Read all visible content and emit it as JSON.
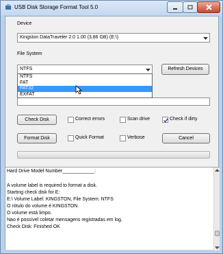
{
  "window": {
    "title": "USB Disk Storage Format Tool 5.0"
  },
  "device": {
    "label": "Device",
    "selected": "Kingston  DataTraveler 2.0  1.00 (3,86 GB) (E:\\)"
  },
  "file_system": {
    "label": "File System",
    "selected": "NTFS",
    "options": [
      "NTFS",
      "FAT",
      "FAT32",
      "EXFAT"
    ],
    "highlighted": "FAT32"
  },
  "buttons": {
    "refresh": "Refresh Devices",
    "check_disk": "Check Disk",
    "format_disk": "Format Disk",
    "cancel": "Cancel"
  },
  "checkboxes": {
    "correct_errors": {
      "label": "Correct errors",
      "checked": false
    },
    "scan_drive": {
      "label": "Scan drive",
      "checked": false
    },
    "check_if_dirty": {
      "label": "Check if dirty",
      "checked": true
    },
    "quick_format": {
      "label": "Quick Format",
      "checked": false
    },
    "verbose": {
      "label": "Verbose",
      "checked": false
    }
  },
  "progress": {
    "value": 0
  },
  "log": {
    "lines": [
      "Hard Drive Model Number____________:",
      "",
      "A volume label is required to format a disk.",
      "Starting check disk for E:",
      "E:\\ Volume Label: KINGSTON, File System: NTFS",
      "O rótulo do volume é KINGSTON.",
      "O volume está limpo.",
      "Nao é possível coletar mensagens registradas em log.",
      "Check Disk: Finished OK"
    ]
  },
  "colors": {
    "frame": "#b9d1ea",
    "selection": "#3399ff",
    "close_button": "#c9462c"
  }
}
